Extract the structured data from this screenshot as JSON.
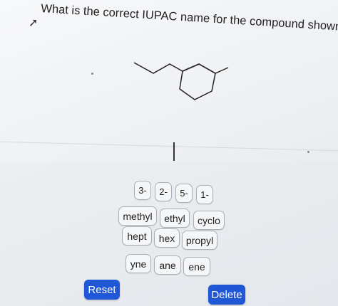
{
  "question": {
    "text": "What is the correct IUPAC name for the compound shown here?"
  },
  "locants": [
    "3-",
    "2-",
    "5-",
    "1-"
  ],
  "fragments": {
    "row1": [
      "methyl",
      "ethyl",
      "cyclo"
    ],
    "row2": [
      "hept",
      "hex",
      "propyl"
    ],
    "row3": [
      "yne",
      "ane",
      "ene"
    ]
  },
  "buttons": {
    "reset": "Reset",
    "delete": "Delete"
  },
  "colors": {
    "button": "#1f57d6",
    "tile_border": "#a9b0b8"
  }
}
